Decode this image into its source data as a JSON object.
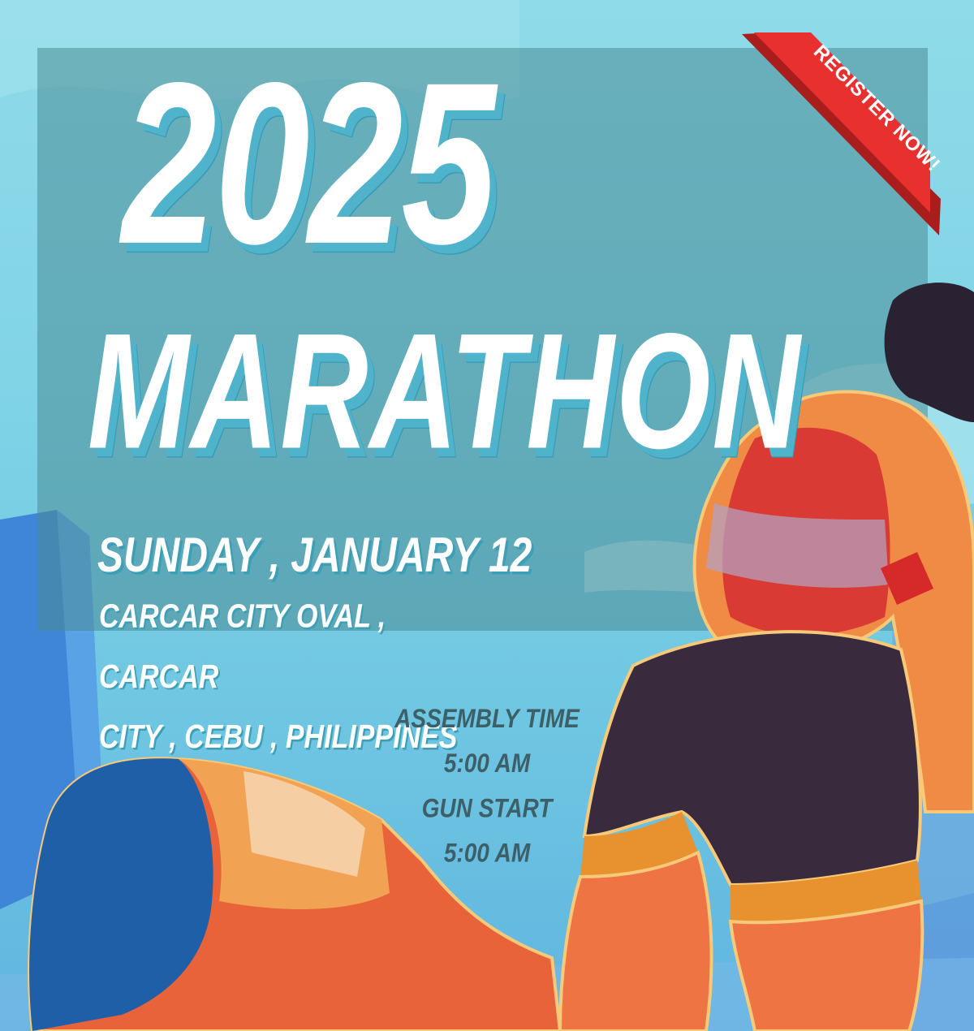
{
  "ribbon": {
    "label": "REGISTER NOW!"
  },
  "headline": {
    "year": "2025",
    "event": "MARATHON"
  },
  "details": {
    "date": "SUNDAY , JANUARY 12",
    "venue_line1": "CARCAR CITY OVAL , CARCAR",
    "venue_line2": "CITY , CEBU , PHILIPPINES"
  },
  "schedule": {
    "assembly_label": "ASSEMBLY TIME",
    "assembly_time": "5:00 AM",
    "gun_label": "GUN START",
    "gun_time": "5:00 AM"
  },
  "colors": {
    "sky": "#8fdbe9",
    "panel": "#4b8c96",
    "ribbon": "#e8302f",
    "text": "#ffffff",
    "shadow": "#4fb3cc",
    "schedule_text": "#3d6068"
  },
  "icons": {
    "illustration": "runner-illustration"
  }
}
